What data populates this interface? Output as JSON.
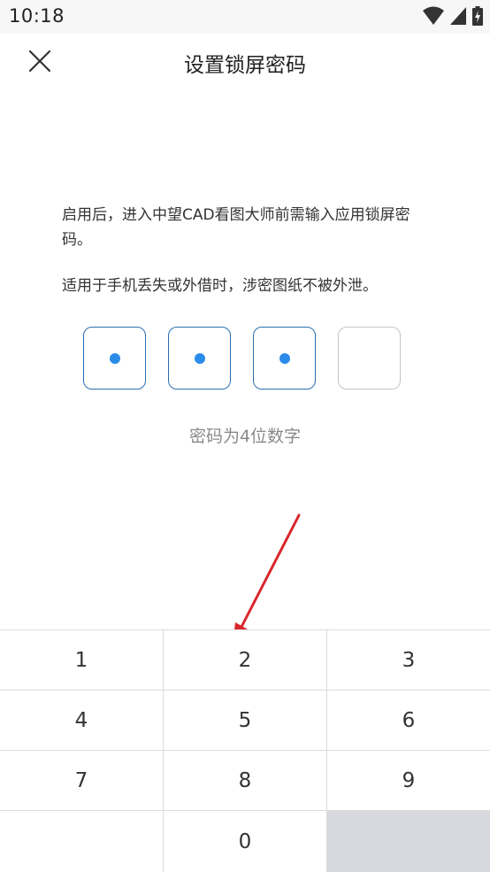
{
  "status_bar": {
    "time": "10:18",
    "icons": [
      "wifi-icon",
      "signal-icon",
      "battery-charging-icon"
    ]
  },
  "header": {
    "title": "设置锁屏密码",
    "close_icon": "close-icon"
  },
  "description": {
    "line1": "启用后，进入中望CAD看图大师前需输入应用锁屏密码。",
    "line2": "适用于手机丢失或外借时，涉密图纸不被外泄。"
  },
  "pin": {
    "length": 4,
    "filled": 3
  },
  "hint": "密码为4位数字",
  "keypad": {
    "keys": [
      "1",
      "2",
      "3",
      "4",
      "5",
      "6",
      "7",
      "8",
      "9",
      "",
      "0",
      ""
    ]
  },
  "colors": {
    "accent": "#2b8be8",
    "pin_border": "#2a6fb0",
    "annotation_arrow": "#d9262b"
  }
}
